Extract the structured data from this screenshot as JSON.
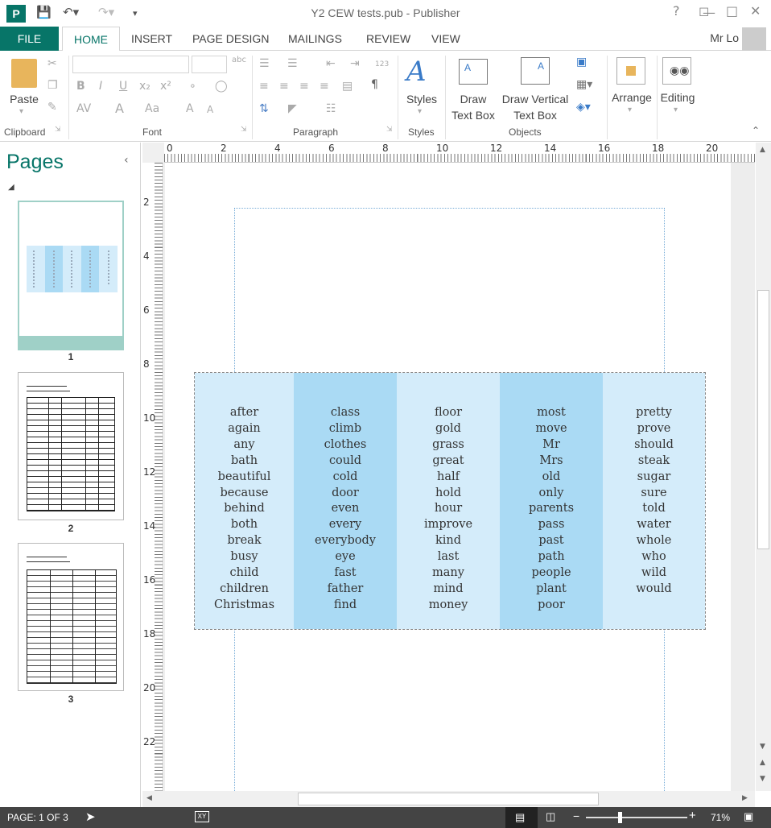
{
  "window": {
    "title": "Y2 CEW tests.pub - Publisher",
    "user": "Mr Lo",
    "help": "?"
  },
  "ribbon": {
    "tabs": [
      {
        "label": "FILE"
      },
      {
        "label": "HOME"
      },
      {
        "label": "INSERT"
      },
      {
        "label": "PAGE DESIGN"
      },
      {
        "label": "MAILINGS"
      },
      {
        "label": "REVIEW"
      },
      {
        "label": "VIEW"
      }
    ],
    "clipboard": {
      "paste": "Paste",
      "group": "Clipboard"
    },
    "font": {
      "group": "Font",
      "bold": "B",
      "italic": "I",
      "underline": "U",
      "subscript": "x₂",
      "superscript": "x²",
      "spacing": "AV",
      "grow": "A",
      "case": "Aa",
      "size_up": "A",
      "size_down": "A",
      "abc": "abc"
    },
    "paragraph": {
      "group": "Paragraph",
      "pilcrow": "¶",
      "numbering": "123"
    },
    "styles": {
      "label": "Styles",
      "group": "Styles"
    },
    "objects": {
      "draw_text_box_1": "Draw",
      "draw_text_box_2": "Text Box",
      "draw_vertical_1": "Draw Vertical",
      "draw_vertical_2": "Text Box",
      "group": "Objects"
    },
    "arrange": {
      "label": "Arrange"
    },
    "editing": {
      "label": "Editing"
    }
  },
  "pages_pane": {
    "title": "Pages",
    "pages": [
      {
        "num": "1"
      },
      {
        "num": "2"
      },
      {
        "num": "3"
      }
    ]
  },
  "rulers": {
    "horizontal": [
      "0",
      "2",
      "4",
      "6",
      "8",
      "10",
      "12",
      "14",
      "16",
      "18",
      "20"
    ],
    "vertical": [
      "2",
      "4",
      "6",
      "8",
      "10",
      "12",
      "14",
      "16",
      "18",
      "20",
      "22"
    ]
  },
  "word_table": {
    "columns": [
      {
        "bg": "#d4ecfa",
        "words": [
          "after",
          "again",
          "any",
          "bath",
          "beautiful",
          "because",
          "behind",
          "both",
          "break",
          "busy",
          "child",
          "children",
          "Christmas"
        ]
      },
      {
        "bg": "#aadaf4",
        "words": [
          "class",
          "climb",
          "clothes",
          "could",
          "cold",
          "door",
          "even",
          "every",
          "everybody",
          "eye",
          "fast",
          "father",
          "find"
        ]
      },
      {
        "bg": "#d4ecfa",
        "words": [
          "floor",
          "gold",
          "grass",
          "great",
          "half",
          "hold",
          "hour",
          "improve",
          "kind",
          "last",
          "many",
          "mind",
          "money"
        ]
      },
      {
        "bg": "#aadaf4",
        "words": [
          "most",
          "move",
          "Mr",
          "Mrs",
          "old",
          "only",
          "parents",
          "pass",
          "past",
          "path",
          "people",
          "plant",
          "poor"
        ]
      },
      {
        "bg": "#d4ecfa",
        "words": [
          "pretty",
          "prove",
          "should",
          "steak",
          "sugar",
          "sure",
          "told",
          "water",
          "whole",
          "who",
          "wild",
          "would"
        ]
      }
    ]
  },
  "status_bar": {
    "page": "PAGE: 1 OF 3",
    "zoom": "71%"
  },
  "colors": {
    "accent": "#077568",
    "status_bg": "#444444"
  }
}
